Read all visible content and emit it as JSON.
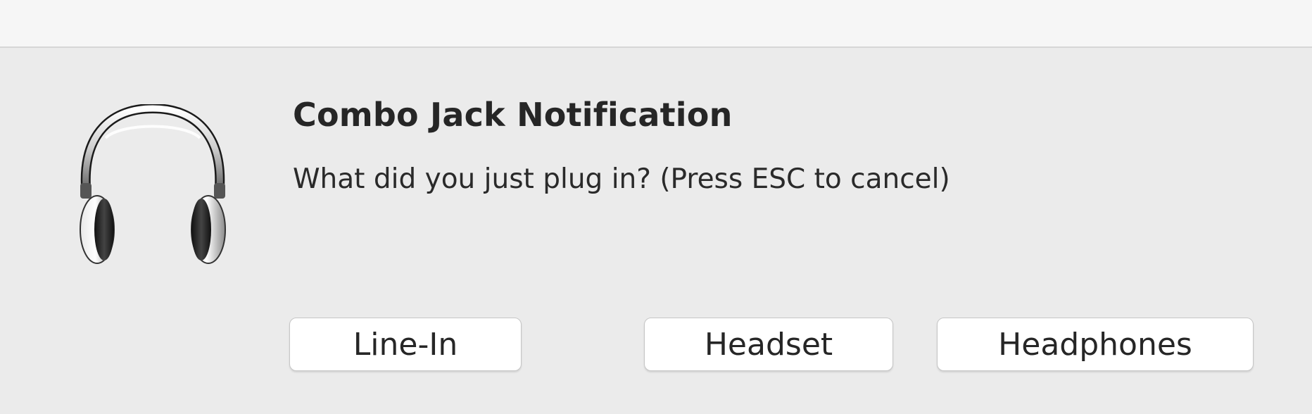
{
  "dialog": {
    "title": "Combo Jack Notification",
    "message": "What did you just plug in? (Press ESC to cancel)",
    "icon": "headphones-icon"
  },
  "buttons": {
    "line_in": "Line-In",
    "headset": "Headset",
    "headphones": "Headphones"
  },
  "colors": {
    "background": "#ebebeb",
    "titlebar": "#f6f6f6",
    "button_background": "#ffffff",
    "text": "#262626"
  }
}
